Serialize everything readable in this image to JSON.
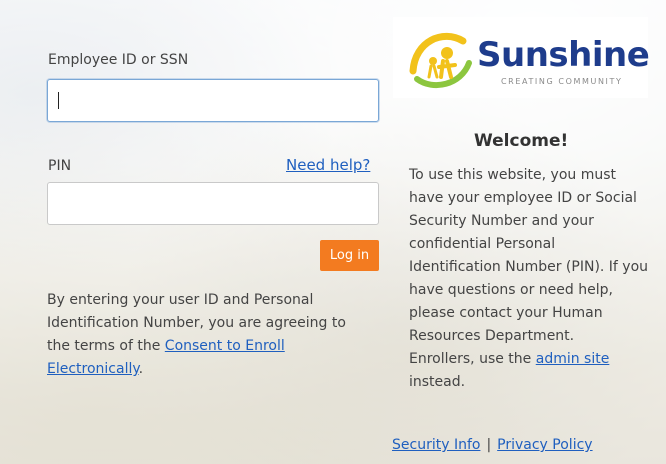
{
  "login": {
    "employee_label": "Employee ID or SSN",
    "employee_value": "",
    "pin_label": "PIN",
    "pin_value": "",
    "need_help": "Need help?",
    "login_button": "Log in"
  },
  "legal": {
    "text_before": "By entering your user ID and Personal Identification Number, you are agreeing to the terms of the ",
    "consent_link": "Consent to Enroll Electronically",
    "text_after": "."
  },
  "logo": {
    "name": "Sunshine",
    "tagline": "CREATING COMMUNITY",
    "icon": "sunshine-logo-icon"
  },
  "welcome": {
    "title": "Welcome!",
    "body": "To use this website, you must have your employee ID or Social Security Number and your confidential Personal Identification Number (PIN). If you have questions or need help, please contact your Human Resources Department.",
    "enrollers_before": "Enrollers, use the ",
    "admin_link": "admin site",
    "enrollers_after": " instead."
  },
  "footer": {
    "security_info": "Security Info",
    "separator": "|",
    "privacy_policy": "Privacy Policy"
  },
  "colors": {
    "accent": "#f37b20",
    "link": "#1f5fbf",
    "brand": "#1e3c8c"
  }
}
